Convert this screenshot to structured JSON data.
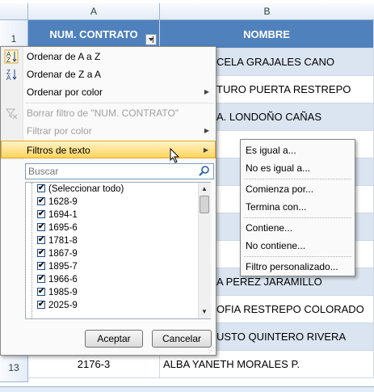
{
  "columns": {
    "a": "A",
    "b": "B"
  },
  "row_numbers": {
    "r1": "1",
    "r13": "13"
  },
  "header_row": {
    "a": "NUM. CONTRATO",
    "b": "NOMBRE"
  },
  "visible_names": [
    "CELA GRAJALES CANO",
    "TURO PUERTA RESTREPO",
    "A. LONDOÑO CAÑAS",
    "A PEREZ JARAMILLO",
    "OFIA RESTREPO COLORADO",
    "USTO QUINTERO RIVERA"
  ],
  "row13": {
    "a": "2176-3",
    "b": "ALBA YANETH MORALES P."
  },
  "menu": {
    "sort_az": "Ordenar de A a Z",
    "sort_za": "Ordenar de Z a A",
    "sort_color": "Ordenar por color",
    "clear_filter": "Borrar filtro de \"NUM. CONTRATO\"",
    "filter_color": "Filtrar por color",
    "text_filters": "Filtros de texto"
  },
  "search": {
    "placeholder": "Buscar"
  },
  "list_items": [
    "(Seleccionar todo)",
    "1628-9",
    "1694-1",
    "1695-6",
    "1781-8",
    "1867-9",
    "1895-7",
    "1966-6",
    "1985-9",
    "2025-9"
  ],
  "buttons": {
    "ok": "Aceptar",
    "cancel": "Cancelar"
  },
  "submenu": {
    "equals": "Es igual a...",
    "not_equals": "No es igual a...",
    "begins": "Comienza por...",
    "ends": "Termina con...",
    "contains": "Contiene...",
    "not_contains": "No contiene...",
    "custom": "Filtro personalizado..."
  },
  "colors": {
    "header_fill": "#4f81bd",
    "band_fill": "#dbe5f1",
    "highlight": "#ffd45e"
  }
}
